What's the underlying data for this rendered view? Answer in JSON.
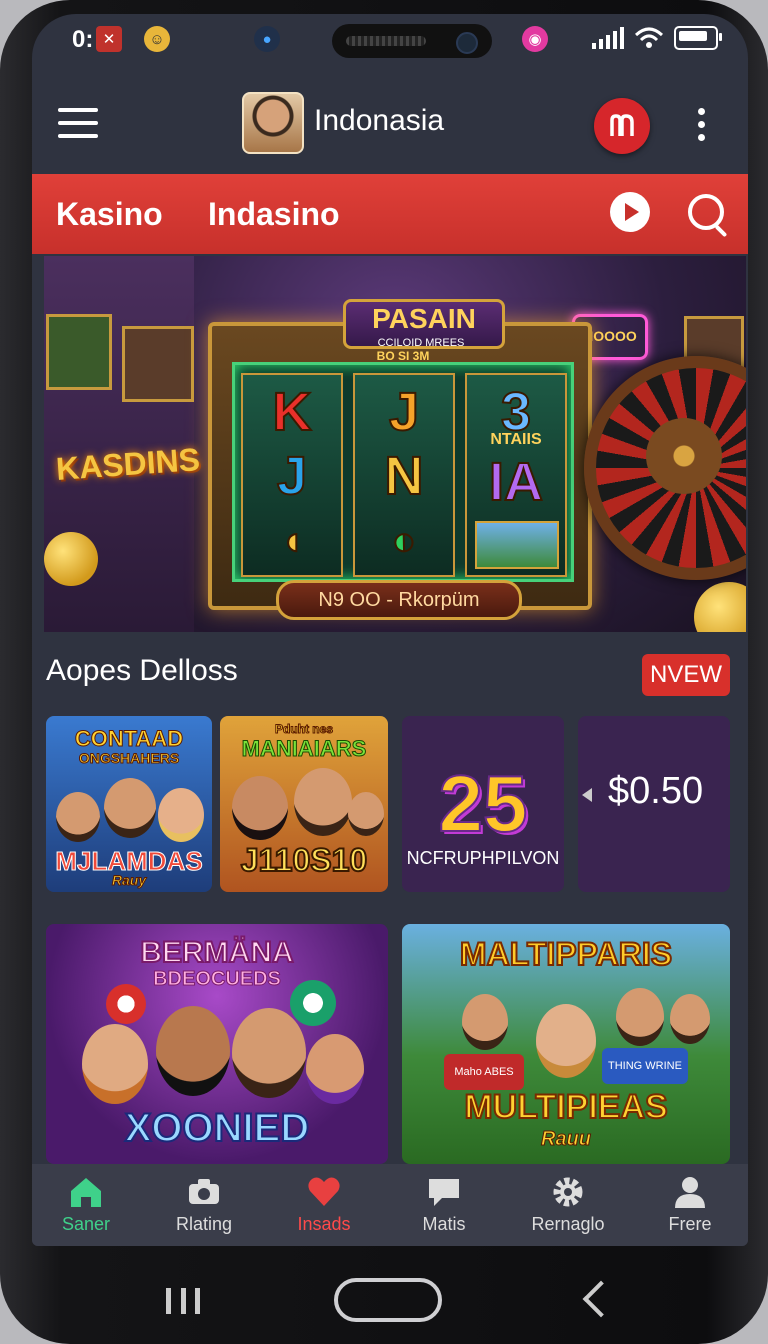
{
  "status_bar": {
    "time": "0:",
    "badge_icon": "notification-icon"
  },
  "app_bar": {
    "title": "Indonasia",
    "avatar": "profile-avatar"
  },
  "category_bar": {
    "tab1": "Kasino",
    "tab2": "Indasino"
  },
  "banner": {
    "slot_title": "PASAIN",
    "slot_subtitle": "CCILOID MREES",
    "slot_top": "BO SI 3M",
    "side_sign": "KASDINS",
    "neon_sign": "NOOOO",
    "reel_symbols": [
      [
        "K",
        "J",
        ""
      ],
      [
        "J",
        "N",
        ""
      ],
      [
        "3",
        "IA",
        ""
      ]
    ],
    "reel_small_label": "NTAIIS",
    "footer": "N9 OO - Rkorpüm"
  },
  "section": {
    "title": "Aopes Delloss",
    "badge": "NVEW"
  },
  "cards": {
    "card1": {
      "top": "CONTAAD",
      "sub": "ONGSHAHERS",
      "bottom": "MJLAMDAS",
      "script": "Rauy"
    },
    "card2": {
      "sub": "Pduht nes",
      "top": "MANIAIARS",
      "bottom": "J110S10"
    },
    "promo": {
      "number": "25",
      "label": "NCFRUPHPILVON"
    },
    "price": {
      "value": "$0.50"
    },
    "card3": {
      "top": "BERMÄNA",
      "sub": "BDEOCUEDS",
      "bottom": "XOONIED"
    },
    "card4": {
      "top": "MALTIPPARIS",
      "bottom": "MULTIPIEAS",
      "script": "Rauu",
      "jersey": "THING WRINE",
      "shirt": "Maho ABES"
    }
  },
  "tabs": [
    {
      "label": "Saner",
      "icon": "home-icon"
    },
    {
      "label": "Rlating",
      "icon": "camera-icon"
    },
    {
      "label": "Insads",
      "icon": "heart-icon"
    },
    {
      "label": "Matis",
      "icon": "chat-icon"
    },
    {
      "label": "Rernaglo",
      "icon": "gear-icon"
    },
    {
      "label": "Frere",
      "icon": "user-icon"
    }
  ],
  "colors": {
    "accent_red": "#d8302b",
    "active_green": "#3fd18a",
    "background": "#2f3340"
  }
}
